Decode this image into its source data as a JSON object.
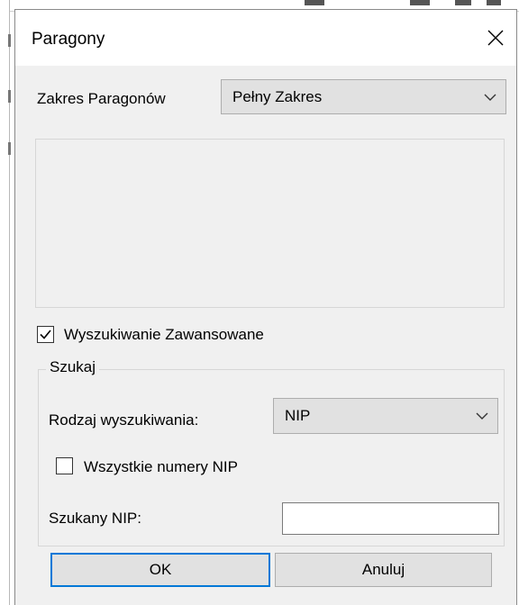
{
  "dialog": {
    "title": "Paragony"
  },
  "range": {
    "label": "Zakres Paragonów",
    "selected": "Pełny Zakres"
  },
  "advanced_search": {
    "label": "Wyszukiwanie Zawansowane",
    "checked": true
  },
  "search_group": {
    "legend": "Szukaj",
    "type_label": "Rodzaj wyszukiwania:",
    "type_selected": "NIP",
    "all_nip_label": "Wszystkie numery NIP",
    "all_nip_checked": false,
    "nip_label": "Szukany NIP:",
    "nip_value": ""
  },
  "buttons": {
    "ok": "OK",
    "cancel": "Anuluj"
  },
  "icons": {
    "close": "close-icon",
    "dropdown": "chevron-down-icon",
    "check": "checkmark-icon"
  },
  "colors": {
    "dialog_bg": "#f0f0f0",
    "focus_border": "#0078d7",
    "button_bg": "#e1e1e1"
  }
}
